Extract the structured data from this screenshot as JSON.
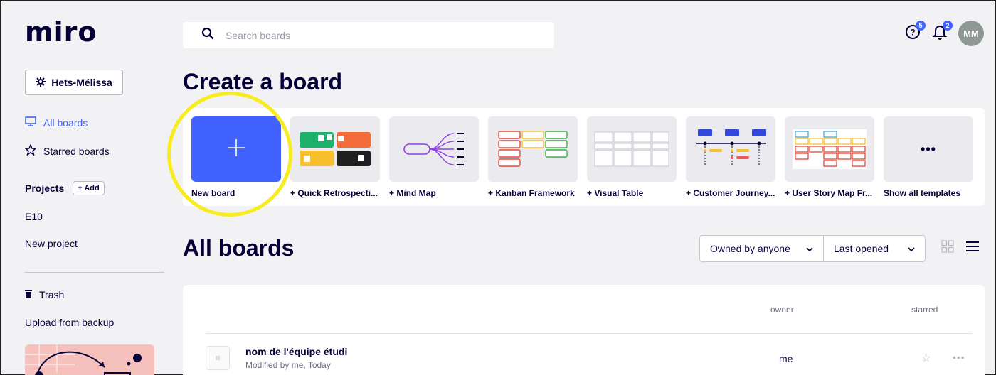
{
  "app": {
    "logo": "miro"
  },
  "sidebar": {
    "team_label": "Hets-Mélissa",
    "items": [
      {
        "label": "All boards",
        "icon": "board-icon",
        "active": true
      },
      {
        "label": "Starred boards",
        "icon": "star-icon",
        "active": false
      }
    ],
    "projects_label": "Projects",
    "add_label": "+ Add",
    "projects": [
      "E10",
      "New project"
    ],
    "trash_label": "Trash",
    "upload_label": "Upload from backup"
  },
  "topbar": {
    "search_placeholder": "Search boards",
    "help_badge": "5",
    "notif_badge": "2",
    "avatar_initials": "MM"
  },
  "create": {
    "title": "Create a board",
    "templates": [
      {
        "label": "New board"
      },
      {
        "label": "+ Quick Retrospecti..."
      },
      {
        "label": "+ Mind Map"
      },
      {
        "label": "+ Kanban Framework"
      },
      {
        "label": "+ Visual Table"
      },
      {
        "label": "+ Customer Journey..."
      },
      {
        "label": "+ User Story Map Fr..."
      },
      {
        "label": "Show all templates"
      }
    ]
  },
  "boards": {
    "title": "All boards",
    "filter_owner": "Owned by anyone",
    "filter_sort": "Last opened",
    "col_owner": "owner",
    "col_starred": "starred",
    "rows": [
      {
        "name": "nom de l'équipe étudi",
        "meta": "Modified by me, Today",
        "owner": "me"
      }
    ]
  },
  "colors": {
    "accent": "#4262ff",
    "highlight": "#f7ec1e",
    "dark": "#050038"
  }
}
